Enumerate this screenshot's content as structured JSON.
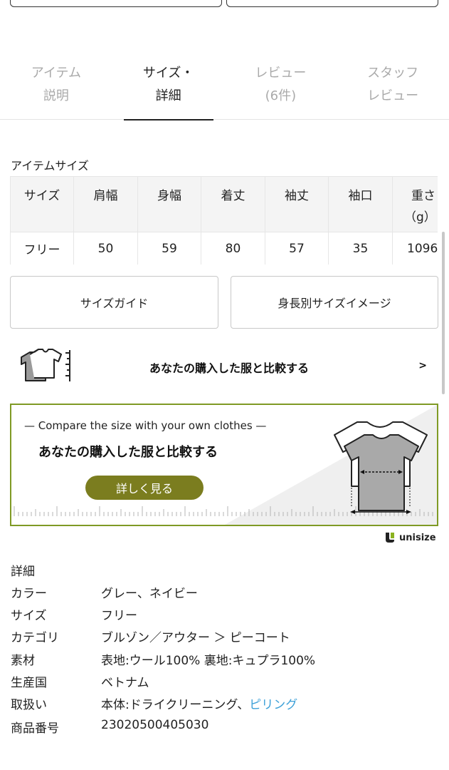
{
  "tabs": [
    {
      "line1": "アイテム",
      "line2": "説明"
    },
    {
      "line1": "サイズ・",
      "line2": "詳細"
    },
    {
      "line1": "レビュー",
      "line2": "(6件)"
    },
    {
      "line1": "スタッフ",
      "line2": "レビュー"
    }
  ],
  "size_section": {
    "title": "アイテムサイズ",
    "headers": [
      "サイズ",
      "肩幅",
      "身幅",
      "着丈",
      "袖丈",
      "袖口",
      "重さ"
    ],
    "weight_unit": "（g）",
    "row": [
      "フリー",
      "50",
      "59",
      "80",
      "57",
      "35",
      "1096"
    ]
  },
  "buttons": {
    "size_guide": "サイズガイド",
    "height_image": "身長別サイズイメージ"
  },
  "compare": {
    "label": "あなたの購入した服と比較する",
    "chevron": ">"
  },
  "banner": {
    "en_subtitle": "— Compare the size with your own clothes —",
    "jp_title": "あなたの購入した服と比較する",
    "button": "詳しく見る",
    "accent_color": "#7f9a25",
    "button_color": "#7b7d1f"
  },
  "unisize_logo": "unisize",
  "details": {
    "title": "詳細",
    "color_label": "カラー",
    "color_value": "グレー、ネイビー",
    "size_label": "サイズ",
    "size_value": "フリー",
    "category_label": "カテゴリ",
    "category_link": "ブルゾン／アウター ＞ ピーコート",
    "material_label": "素材",
    "material_value": "表地:ウール100% 裏地:キュプラ100%",
    "origin_label": "生産国",
    "origin_value": "ベトナム",
    "care_label": "取扱い",
    "care_value": "本体:ドライクリーニング、",
    "care_link": "ピリング",
    "number_label": "商品番号",
    "number_value": "23020500405030"
  },
  "link_color": "#3ea1d8"
}
